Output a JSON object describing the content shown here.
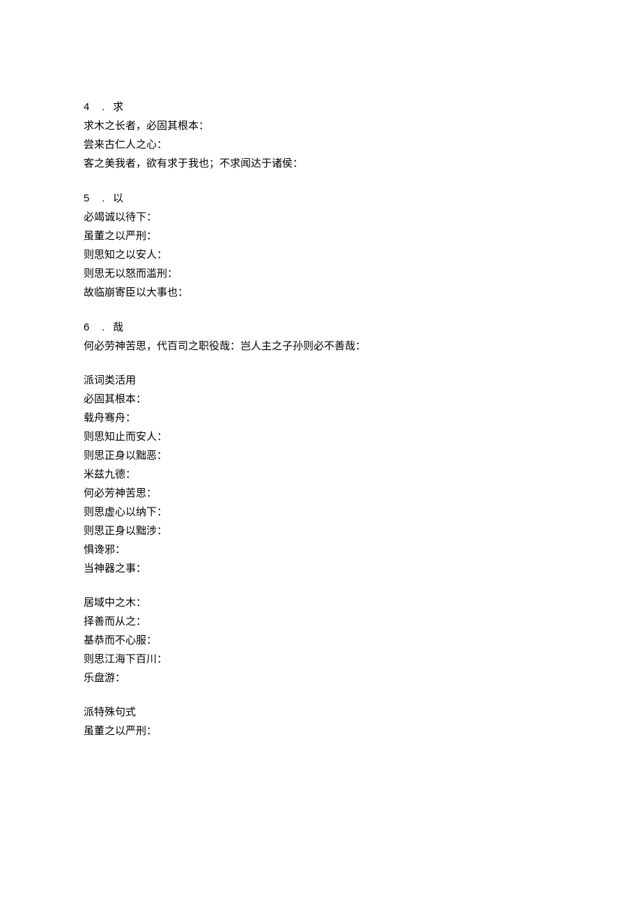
{
  "sections": {
    "s4": {
      "num": "4",
      "dot": ".",
      "title": "求",
      "lines": [
        "求木之长者，必固其根本：",
        "尝来古仁人之心：",
        "客之美我者，欲有求于我也；不求闻达于诸侯："
      ]
    },
    "s5": {
      "num": "5",
      "dot": ".",
      "title": "以",
      "lines": [
        "必竭诚以待下：",
        "虽董之以严刑：",
        "则思知之以安人：",
        "则思无以怒而滥刑：",
        "故临崩寄臣以大事也："
      ]
    },
    "s6": {
      "num": "6",
      "dot": ".",
      "title": "哉",
      "lines": [
        "何必劳神苦思，代百司之职役哉：岂人主之子孙则必不善哉："
      ]
    },
    "block1": {
      "lines": [
        "派词类活用",
        "必固其根本：",
        "载舟骞舟：",
        "则思知止而安人：",
        "则思正身以黜恶：",
        "米兹九德：",
        "何必芳神苦思：",
        "则思虚心以纳下：",
        "则思正身以黜涉：",
        "惧谗邪：",
        "当神器之事："
      ]
    },
    "block2": {
      "lines": [
        "居域中之木：",
        "择善而从之：",
        "基恭而不心服：",
        "则思江海下百川：",
        "乐盘游："
      ]
    },
    "block3": {
      "lines": [
        "派特殊句式",
        "虽董之以严刑："
      ]
    }
  }
}
